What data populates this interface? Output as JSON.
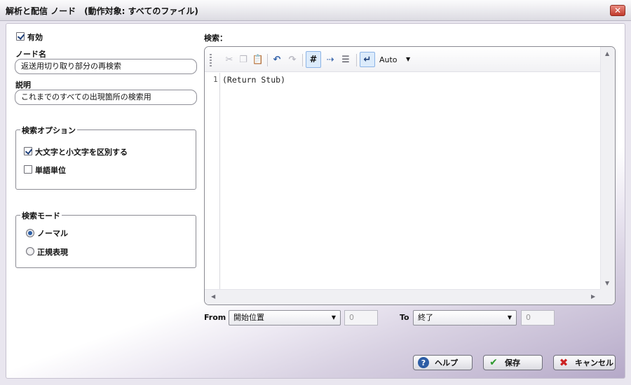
{
  "window": {
    "title": "解析と配信 ノード　(動作対象: すべてのファイル)",
    "close_icon": "close-icon"
  },
  "enabled": {
    "label": "有効",
    "checked": true
  },
  "node_name": {
    "label": "ノード名",
    "value": "返送用切り取り部分の再検索"
  },
  "description": {
    "label": "説明",
    "value": "これまでのすべての出現箇所の検索用"
  },
  "search_options": {
    "title": "検索オプション",
    "case_sensitive": {
      "label": "大文字と小文字を区別する",
      "checked": true
    },
    "whole_word": {
      "label": "単語単位",
      "checked": false
    }
  },
  "search_mode": {
    "title": "検索モード",
    "normal": {
      "label": "ノーマル",
      "selected": true
    },
    "regex": {
      "label": "正規表現",
      "selected": false
    }
  },
  "search": {
    "label": "検索：",
    "toolbar": {
      "wrap_mode": "Auto"
    },
    "line_number": "1",
    "code": "(Return Stub)"
  },
  "range": {
    "from_label": "From",
    "from_value": "開始位置",
    "from_offset": "0",
    "to_label": "To",
    "to_value": "終了",
    "to_offset": "0"
  },
  "buttons": {
    "help": "ヘルプ",
    "save": "保存",
    "cancel": "キャンセル"
  }
}
